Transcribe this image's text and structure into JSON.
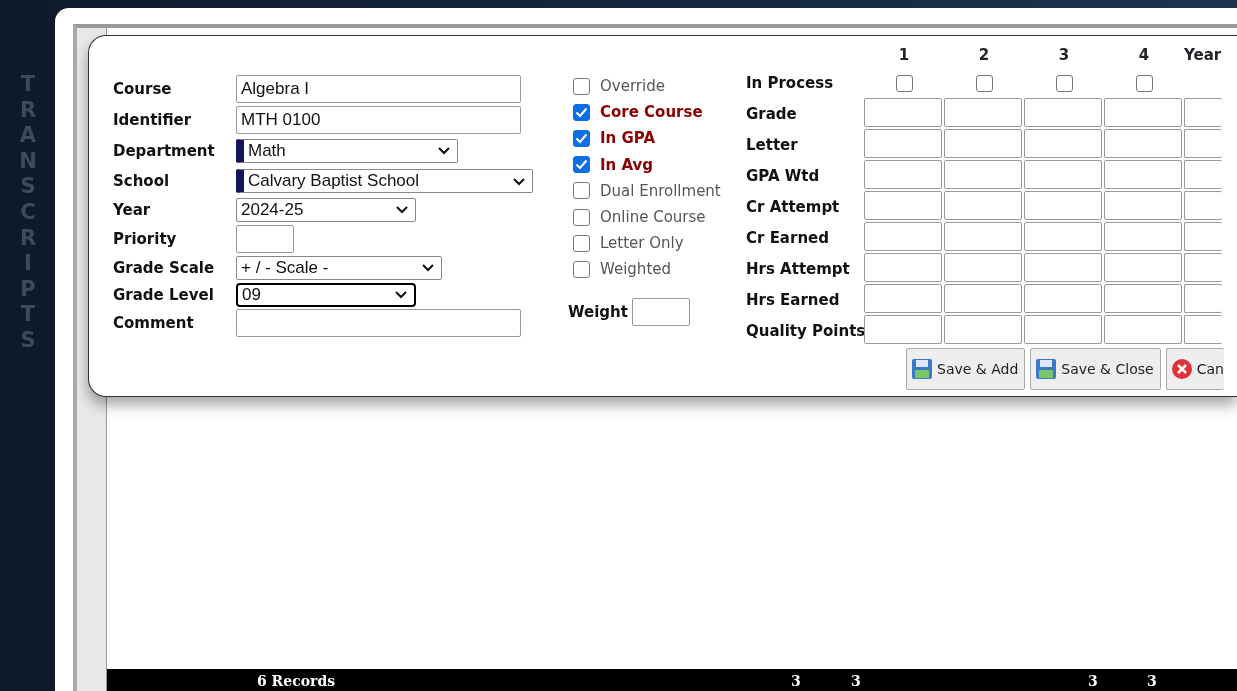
{
  "sidebar": {
    "title": "TRANSCRIPTS"
  },
  "fields": [
    {
      "label": "Course",
      "kind": "text",
      "value": "Algebra I"
    },
    {
      "label": "Identifier",
      "kind": "text",
      "value": "MTH 0100"
    },
    {
      "label": "Department",
      "kind": "select",
      "value": "Math",
      "marked": true,
      "focused": false
    },
    {
      "label": "School",
      "kind": "select",
      "value": "Calvary Baptist School",
      "marked": true,
      "focused": false
    },
    {
      "label": "Year",
      "kind": "select",
      "value": "2024-25",
      "marked": false,
      "focused": false
    },
    {
      "label": "Priority",
      "kind": "text"
    },
    {
      "label": "Grade Scale",
      "kind": "select",
      "value": "+ / - Scale -",
      "marked": false,
      "focused": false
    },
    {
      "label": "Grade Level",
      "kind": "select",
      "value": "09",
      "marked": false,
      "focused": true
    },
    {
      "label": "Comment",
      "kind": "text"
    }
  ],
  "options": [
    {
      "label": "Override",
      "checked": false
    },
    {
      "label": "Core Course",
      "checked": true
    },
    {
      "label": "In GPA",
      "checked": true
    },
    {
      "label": "In Avg",
      "checked": true
    },
    {
      "label": "Dual Enrollment",
      "checked": false
    },
    {
      "label": "Online Course",
      "checked": false
    },
    {
      "label": "Letter Only",
      "checked": false
    },
    {
      "label": "Weighted",
      "checked": false
    }
  ],
  "weight": {
    "label": "Weight"
  },
  "grid": {
    "columns": [
      "1",
      "2",
      "3",
      "4",
      "Year"
    ],
    "in_process": {
      "label": "In Process",
      "checks": [
        {
          "checked": false
        },
        {
          "checked": false
        },
        {
          "checked": false
        },
        {
          "checked": false
        }
      ]
    },
    "rows": [
      "Grade",
      "Letter",
      "GPA Wtd",
      "Cr Attempt",
      "Cr Earned",
      "Hrs Attempt",
      "Hrs Earned",
      "Quality Points"
    ]
  },
  "buttons": [
    {
      "label": "Save & Add",
      "kind": "save"
    },
    {
      "label": "Save & Close",
      "kind": "save"
    },
    {
      "label": "Can",
      "kind": "cancel"
    }
  ],
  "footer": {
    "records": "6 Records",
    "totals": [
      "3",
      "3",
      "3",
      "3"
    ]
  }
}
